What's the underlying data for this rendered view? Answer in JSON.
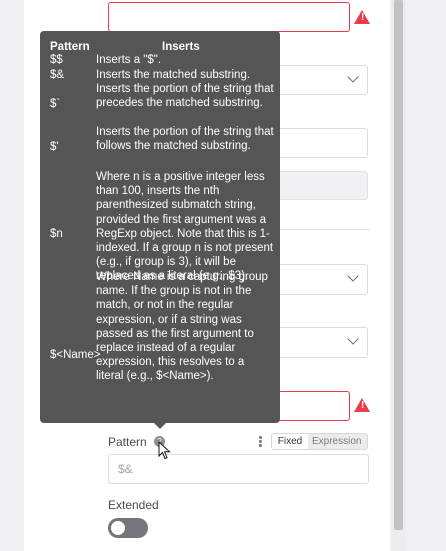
{
  "tooltip": {
    "header_pattern": "Pattern",
    "header_inserts": "Inserts",
    "rows": [
      {
        "pattern": "$$",
        "inserts": "Inserts a \"$\"."
      },
      {
        "pattern": "$&",
        "inserts": "Inserts the matched substring."
      },
      {
        "pattern": "$`",
        "inserts": "Inserts the portion of the string that precedes the matched substring."
      },
      {
        "pattern": "$'",
        "inserts": "Inserts the portion of the string that follows the matched substring."
      },
      {
        "pattern": "$n",
        "inserts": "Where n is a positive integer less than 100, inserts the nth parenthesized submatch string, provided the first argument was a RegExp object. Note that this is 1-indexed. If a group n is not present (e.g., if group is 3), it will be replaced as a literal (e.g., $3)."
      },
      {
        "pattern": "$<Name>",
        "inserts": "Where Name is a capturing group name. If the group is not in the match, or not in the regular expression, or if a string was passed as the first argument to replace instead of a regular expression, this resolves to a literal (e.g., $<Name>)."
      }
    ]
  },
  "pattern_field": {
    "label": "Pattern",
    "placeholder": "$&",
    "help_icon": "question-circle-icon"
  },
  "mode_toggle": {
    "fixed": "Fixed",
    "expression": "Expression",
    "selected": "Fixed"
  },
  "extended": {
    "label": "Extended",
    "enabled": false
  },
  "colors": {
    "error": "#ea3b4a",
    "tooltip_bg": "#555555",
    "toggle_off": "#75757b"
  }
}
